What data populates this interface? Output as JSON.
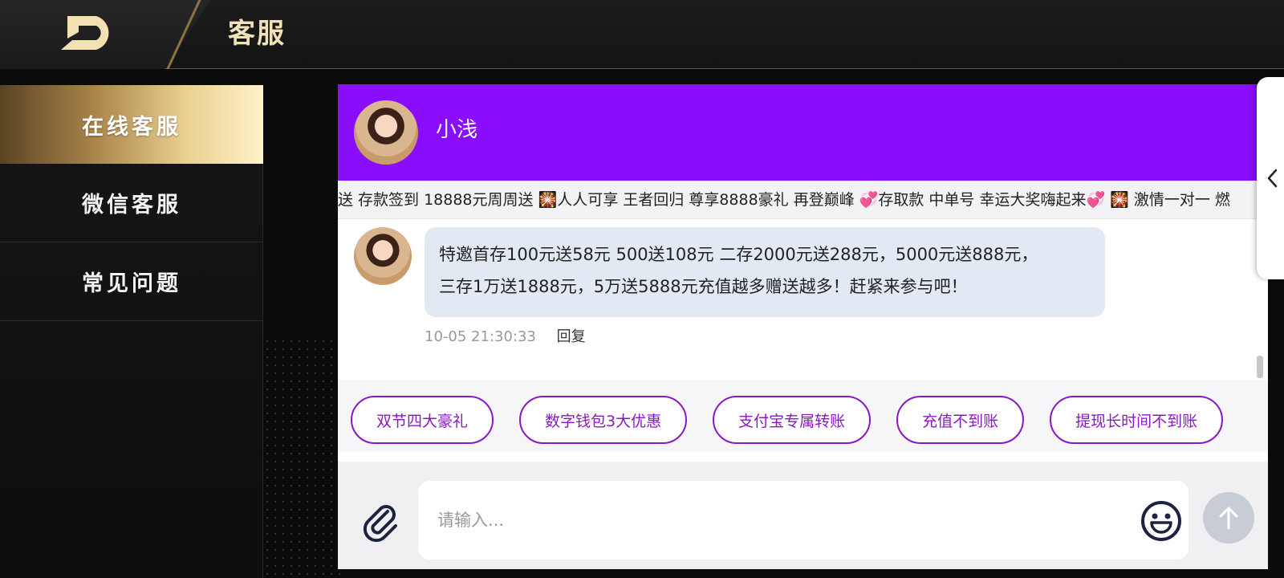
{
  "header": {
    "title": "客服",
    "logo_icon": "brand-logo-icon"
  },
  "sidebar": {
    "items": [
      {
        "label": "在线客服",
        "active": true
      },
      {
        "label": "微信客服",
        "active": false
      },
      {
        "label": "常见问题",
        "active": false
      }
    ]
  },
  "chat": {
    "agent_name": "小浅",
    "header_color": "#8a0dfb",
    "marquee": "送 存款签到 18888元周周送 🎇人人可享 王者回归 尊享8888豪礼 再登巅峰 💞存取款 中单号 幸运大奖嗨起来💞 🎇 激情一对一 燃",
    "messages": [
      {
        "line1": "特邀首存100元送58元 500送108元 二存2000元送288元，5000元送888元，",
        "line2": "三存1万送1888元，5万送5888元充值越多赠送越多！赶紧来参与吧！",
        "time": "10-05 21:30:33",
        "reply_label": "回复"
      }
    ],
    "quick_replies": [
      "双节四大豪礼",
      "数字钱包3大优惠",
      "支付宝专属转账",
      "充值不到账",
      "提现长时间不到账"
    ],
    "input": {
      "placeholder": "请输入...",
      "value": ""
    },
    "icons": {
      "attach": "paperclip-icon",
      "emoji": "smiley-icon",
      "send": "arrow-up-icon",
      "collapse": "chevron-left-icon"
    },
    "accent": "#8a17c6"
  }
}
